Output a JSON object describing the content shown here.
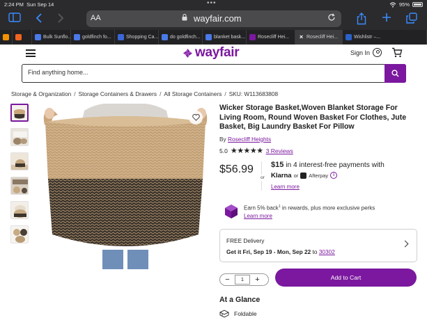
{
  "status_bar": {
    "time": "2:24 PM",
    "date": "Sun Sep 14",
    "battery": "95%"
  },
  "browser": {
    "aa_label": "AA",
    "domain": "wayfair.com",
    "accent_color": "#3a8cff",
    "tabs": [
      {
        "label": "",
        "favicon": "amazon",
        "color": "#f29100"
      },
      {
        "label": "",
        "favicon": "etsy",
        "color": "#f1641e"
      },
      {
        "label": "Bulk Sunflo...",
        "favicon": "google",
        "color": "#4a79e8"
      },
      {
        "label": "goldfinch fo...",
        "favicon": "google",
        "color": "#4a79e8"
      },
      {
        "label": "Shopping Ca...",
        "favicon": "c",
        "color": "#3a66d6"
      },
      {
        "label": "do goldfinch...",
        "favicon": "google",
        "color": "#4a79e8"
      },
      {
        "label": "blanket bask...",
        "favicon": "google",
        "color": "#4a79e8"
      },
      {
        "label": "Rosecliff Hei...",
        "favicon": "wayfair",
        "color": "#7b189f"
      },
      {
        "label": "Rosecliff Hei...",
        "favicon": "close",
        "color": "#444444",
        "active": true
      },
      {
        "label": "Wishlistr –...",
        "favicon": "w",
        "color": "#2962c9"
      }
    ]
  },
  "site": {
    "brand": "wayfair",
    "brand_color": "#7b189f",
    "sign_in": "Sign In",
    "search_placeholder": "Find anything home..."
  },
  "breadcrumb": [
    "Storage & Organization",
    "Storage Containers & Drawers",
    "All Storage Containers",
    "SKU: W113683808"
  ],
  "product": {
    "title": "Wicker Storage Basket,Woven Blanket Storage For Living Room, Round Woven Basket For Clothes, Jute Basket, Big Laundry Basket For Pillow",
    "by_prefix": "By",
    "brand": "Rosecliff Heights",
    "rating": "5.0",
    "stars": "★★★★★",
    "reviews": "3 Reviews",
    "price": "$56.99",
    "or": "or",
    "installment_amount": "$15",
    "installment_text": "in 4 interest-free payments with",
    "klarna": "Klarna",
    "or2": "or",
    "afterpay": "Afterpay",
    "learn_more": "Learn more",
    "rewards_text": "Earn 5% back",
    "rewards_sup": "1",
    "rewards_rest": "in rewards, plus more exclusive perks",
    "rewards_learn": "Learn more",
    "delivery_label": "FREE Delivery",
    "delivery_dates": "Get it Fri, Sep 19 - Mon, Sep 22",
    "delivery_to": "to",
    "zip": "30302",
    "qty": "1",
    "qty_minus": "−",
    "qty_plus": "+",
    "add_to_cart": "Add to Cart",
    "glance_heading": "At a Glance",
    "glance_items": [
      "Foldable"
    ]
  }
}
